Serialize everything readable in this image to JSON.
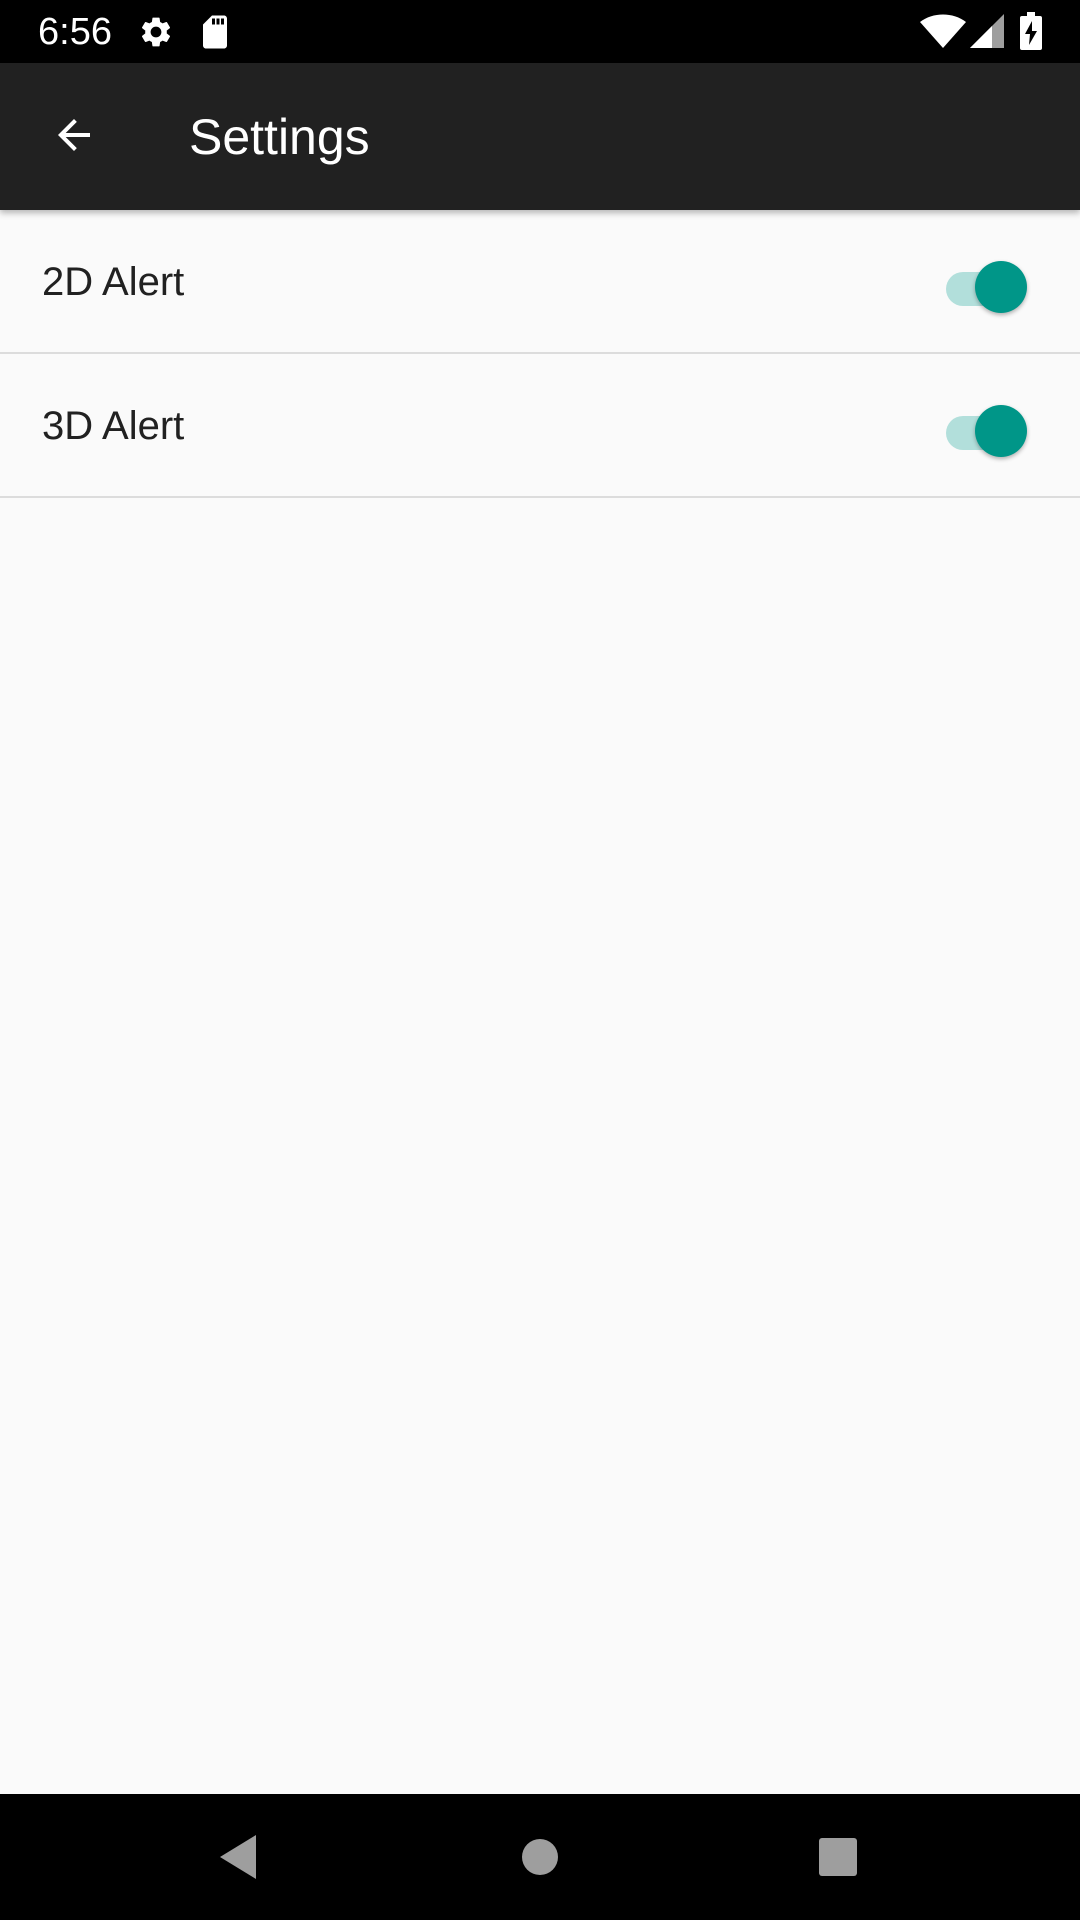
{
  "status_bar": {
    "time": "6:56",
    "icons": [
      "settings-gear-icon",
      "sd-card-icon",
      "wifi-icon",
      "cell-signal-icon",
      "battery-charging-icon"
    ]
  },
  "toolbar": {
    "title": "Settings",
    "back_icon": "arrow-back-icon"
  },
  "settings": [
    {
      "label": "2D Alert",
      "enabled": true
    },
    {
      "label": "3D Alert",
      "enabled": true
    }
  ],
  "nav_bar": {
    "buttons": [
      "back-triangle-icon",
      "home-circle-icon",
      "recents-square-icon"
    ]
  },
  "colors": {
    "accent": "#009688",
    "accent_track": "#b2dfdb",
    "toolbar_bg": "#212121",
    "status_bg": "#000000",
    "page_bg": "#fafafa"
  }
}
